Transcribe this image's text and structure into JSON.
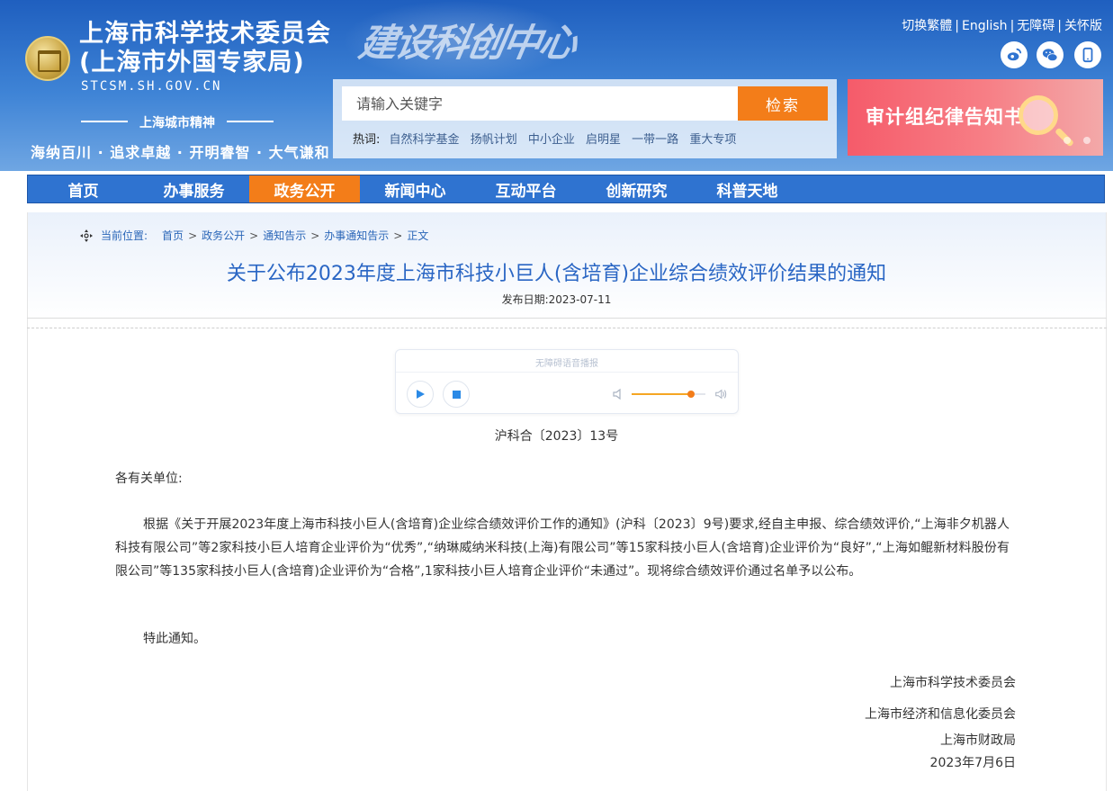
{
  "header": {
    "site_title_line1": "上海市科学技术委员会",
    "site_title_line2": "(上海市外国专家局)",
    "site_domain": "STCSM.SH.GOV.CN",
    "spirit_label": "上海城市精神",
    "spirit_motto": "海纳百川 · 追求卓越 · 开明睿智 · 大气谦和",
    "calligraphy": "建设科创中心",
    "top_links": [
      "切换繁體",
      "English",
      "无障碍",
      "关怀版"
    ],
    "social_icons": [
      "weibo-icon",
      "wechat-icon",
      "mobile-icon"
    ]
  },
  "search": {
    "placeholder": "请输入关键字",
    "button_label": "检索",
    "hot_label": "热词:",
    "hot_keywords": [
      "自然科学基金",
      "扬帆计划",
      "中小企业",
      "启明星",
      "一带一路",
      "重大专项"
    ]
  },
  "banner": {
    "text": "审计组纪律告知书"
  },
  "nav": {
    "items": [
      "首页",
      "办事服务",
      "政务公开",
      "新闻中心",
      "互动平台",
      "创新研究",
      "科普天地"
    ],
    "active": "政务公开"
  },
  "breadcrumb": {
    "label": "当前位置:",
    "items": [
      "首页",
      "政务公开",
      "通知告示",
      "办事通知告示",
      "正文"
    ]
  },
  "article": {
    "title": "关于公布2023年度上海市科技小巨人(含培育)企业综合绩效评价结果的通知",
    "pub_date": "发布日期:2023-07-11",
    "player_title": "无障碍语音播报",
    "doc_no": "沪科合〔2023〕13号",
    "salutation": "各有关单位:",
    "paragraph": "根据《关于开展2023年度上海市科技小巨人(含培育)企业综合绩效评价工作的通知》(沪科〔2023〕9号)要求,经自主申报、综合绩效评价,“上海非夕机器人科技有限公司”等2家科技小巨人培育企业评价为“优秀”,“纳琳威纳米科技(上海)有限公司”等15家科技小巨人(含培育)企业评价为“良好”,“上海如鲲新材料股份有限公司”等135家科技小巨人(含培育)企业评价为“合格”,1家科技小巨人培育企业评价“未通过”。现将综合绩效评价通过名单予以公布。",
    "closing": "特此通知。",
    "signatures": [
      "上海市科学技术委员会",
      "上海市经济和信息化委员会",
      "上海市财政局",
      "2023年7月6日"
    ]
  },
  "colors": {
    "header_blue": "#2f73d0",
    "accent_orange": "#f37d19",
    "title_blue": "#2a66c4",
    "banner_red": "#f55b6a"
  },
  "player": {
    "volume": 0.8
  }
}
